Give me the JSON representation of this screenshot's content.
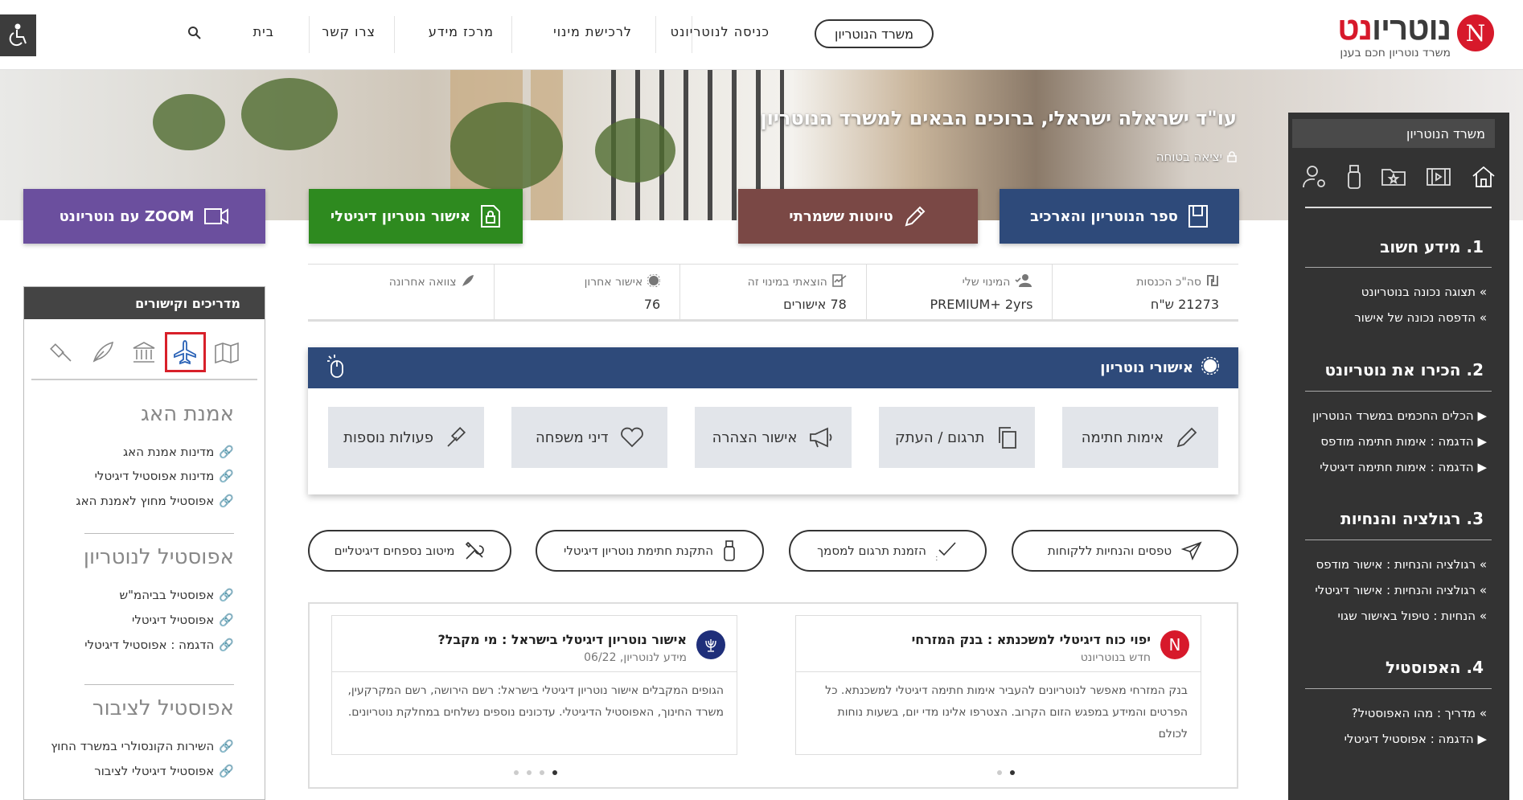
{
  "header": {
    "logo_text_a": "נוטריו",
    "logo_text_b": "נט",
    "logo_letter": "N",
    "logo_tagline": "משרד נוטריון חכם בענן",
    "office_button": "משרד הנוטריון",
    "nav": [
      "כניסה לנוטריונט",
      "לרכישת מינוי",
      "מרכז מידע",
      "צרו קשר",
      "בית"
    ]
  },
  "hero": {
    "welcome": "עו\"ד ישראלה ישראלי, ברוכים הבאים למשרד הנוטריון",
    "logout": "יציאה בטוחה"
  },
  "actions": {
    "book": "ספר הנוטריון והארכיב",
    "drafts": "טיוטות ששמרתי",
    "digital": "אישור נוטריון דיגיטלי",
    "zoom": "ZOOM עם נוטריונט"
  },
  "stats": [
    {
      "label": "סה\"כ הכנסות",
      "value": "21273 ש\"ח"
    },
    {
      "label": "המינוי שלי",
      "value": "PREMIUM+ 2yrs"
    },
    {
      "label": "הוצאתי במינוי זה",
      "value": "78 אישורים"
    },
    {
      "label": "אישור אחרון",
      "value": "76"
    },
    {
      "label": "צוואה אחרונה",
      "value": ""
    }
  ],
  "approvals": {
    "title": "אישורי נוטריון",
    "buttons": [
      "אימות חתימה",
      "תרגום / העתק",
      "אישור הצהרה",
      "דיני משפחה",
      "פעולות נוספות"
    ]
  },
  "pills": [
    "טפסים והנחיות ללקוחות",
    "הזמנת תרגום למסמך",
    "התקנת חתימת נוטריון דיגיטלי",
    "מיטוב נספחים דיגיטליים"
  ],
  "news": [
    {
      "title": "יפוי כוח דיגיטלי למשכנתא : בנק המזרחי",
      "sub": "חדש בנוטריונט",
      "body": "בנק המזרחי מאפשר לנוטריונים להעביר אימות חתימה דיגיטלי למשכנתא. כל הפרטים והמידע במפגש הזום הקרוב. הצטרפו אלינו מדי יום, בשעות נוחות לכולם"
    },
    {
      "title": "אישור נוטריון דיגיטלי בישראל : מי מקבל?",
      "sub": "מידע לנוטריון, 06/22",
      "body": "הגופים המקבלים אישור נוטריון דיגיטלי בישראל: רשם הירושה, רשם המקרקעין, משרד החינוך, האפוסטיל הדיגיטלי. עדכונים נוספים נשלחים במחלקת נוטריונים."
    }
  ],
  "right_panel": {
    "head": "משרד  הנוטריון",
    "sections": [
      {
        "title": "1. מידע חשוב",
        "links": [
          "תצוגה נכונה בנוטריונט",
          "הדפסה נכונה של אישור"
        ]
      },
      {
        "title": "2. הכירו את נוטריונט",
        "links": [
          "הכלים החכמים במשרד הנוטריון",
          "הדגמה : אימות חתימה מודפס",
          "הדגמה : אימות חתימה דיגיטלי"
        ]
      },
      {
        "title": "3. רגולציה והנחיות",
        "links": [
          "רגולציה והנחיות : אישור מודפס",
          "רגולציה והנחיות : אישור דיגיטלי",
          "הנחיות : טיפול באישור שגוי"
        ]
      },
      {
        "title": "4. האפוסטיל",
        "links": [
          "מדריך : מהו האפוסטיל?",
          "הדגמה : אפוסטיל דיגיטלי"
        ]
      }
    ]
  },
  "left_panel": {
    "head": "מדריכים  וקישורים",
    "sections": [
      {
        "title": "אמנת האג",
        "links": [
          "מדינות אמנת האג",
          "מדינות אפוסטיל דיגיטלי",
          "אפוסטיל מחוץ לאמנת האג"
        ]
      },
      {
        "title": "אפוסטיל לנוטריון",
        "links": [
          "אפוסטיל בביהמ\"ש",
          "אפוסטיל דיגיטלי",
          "הדגמה : אפוסטיל דיגיטלי"
        ]
      },
      {
        "title": "אפוסטיל לציבור",
        "links": [
          "השירות הקונסולרי במשרד החוץ",
          "אפוסטיל דיגיטלי לציבור"
        ]
      }
    ]
  },
  "colors": {
    "navy": "#2e4a7a",
    "brown": "#7a4845",
    "green": "#2e8a1f",
    "purple": "#6b4f9e",
    "brand_red": "#d7192b",
    "dark_panel": "#333333"
  }
}
